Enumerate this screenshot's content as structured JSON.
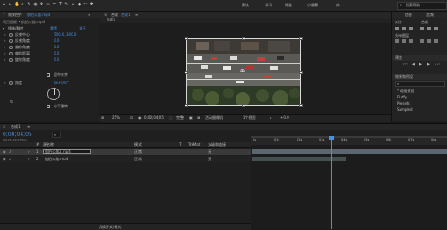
{
  "toolbar": {
    "tools": [
      "home",
      "select",
      "hand",
      "zoom",
      "rotate",
      "camera",
      "pan",
      "rect",
      "pen",
      "text",
      "brush",
      "stamp",
      "eraser",
      "roto",
      "puppet"
    ],
    "workspace": [
      "默认",
      "学习",
      "标准",
      "小屏幕",
      "库"
    ],
    "search_placeholder": "搜索帮助",
    "search_icon": "search-icon"
  },
  "effect_panel": {
    "tab_label": "效果控件",
    "file": "航拍公路.mp4",
    "subtitle": "项目面板 • 航拍公路.mp4",
    "effect_name": "镜像/翻转",
    "reset": "重置",
    "about": "关于",
    "props": [
      {
        "name": "反射中心",
        "value": "500.0, 300.0"
      },
      {
        "name": "反射角度",
        "value": "0.0"
      },
      {
        "name": "偏移角度",
        "value": "0.0"
      },
      {
        "name": "偏移距离",
        "value": "0.0"
      },
      {
        "name": "旋转角度",
        "value": "0.0"
      }
    ],
    "checkbox1": "居中对齐",
    "angle_label": "角度",
    "angle_value": "0x+0.0°",
    "checkbox2": "水平翻转"
  },
  "comp_panel": {
    "tabs": [
      "合成",
      "合成1"
    ],
    "breadcrumb": "合成1",
    "zoom": "25%",
    "timecode": "0;00;04;05",
    "quality": "完整",
    "camera": "活动摄像机",
    "views": "1个视图",
    "extra": "+0.0"
  },
  "right_panel": {
    "tabs": [
      "信息",
      "音频"
    ],
    "align_title": "对齐",
    "align_to": "合成",
    "distribute": "分布图层",
    "preview_title": "预览",
    "effects_title": "效果和预设",
    "search_placeholder": "",
    "tree": [
      "* 动画预设",
      "Fluffy",
      "Presets",
      "Sampled"
    ]
  },
  "timeline": {
    "tab": "合成1",
    "timecode": "0;00;04;05",
    "fps_label": "00125 (29.97 fps)",
    "columns": [
      "#",
      "源名称",
      "父级和链接",
      "模式",
      "T",
      "TrkMat"
    ],
    "layers": [
      {
        "num": "1",
        "name": "航拍公路2.mp4",
        "mode": "正常",
        "parent": "无"
      },
      {
        "num": "2",
        "name": "航拍公路.mp4",
        "mode": "正常",
        "parent": "无"
      }
    ],
    "ruler": [
      "0s",
      "01s",
      "02s",
      "03s",
      "04s",
      "05s",
      "06s",
      "07s",
      "08s"
    ],
    "bottom": "切换开关/模式"
  }
}
